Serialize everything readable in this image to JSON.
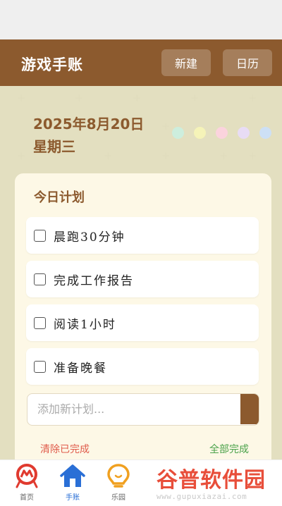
{
  "app": {
    "title": "游戏手账",
    "buttons": {
      "new": "新建",
      "calendar": "日历"
    }
  },
  "header": {
    "date": "2025年8月20日",
    "weekday": "星期三",
    "theme_dots": [
      "#cdeedd",
      "#f5f3b8",
      "#fbd3dd",
      "#e8dcf5",
      "#cde0f5"
    ]
  },
  "plan": {
    "title": "今日计划",
    "tasks": [
      {
        "label": "晨跑30分钟",
        "done": false
      },
      {
        "label": "完成工作报告",
        "done": false
      },
      {
        "label": "阅读1小时",
        "done": false
      },
      {
        "label": "准备晚餐",
        "done": false
      }
    ],
    "input_placeholder": "添加新计划...",
    "clear_done": "清除已完成",
    "complete_all": "全部完成"
  },
  "tabbar": {
    "tabs": [
      {
        "label": "首页",
        "icon": "home-brand-icon"
      },
      {
        "label": "手账",
        "icon": "house-icon",
        "active": true
      },
      {
        "label": "乐园",
        "icon": "lightbulb-icon"
      }
    ]
  },
  "watermark": {
    "title": "谷普软件园",
    "url": "www.gupuxiazai.com"
  },
  "colors": {
    "brand": "#8c5a2e",
    "background": "#f3f1d8",
    "danger": "#e05b4b",
    "success": "#4aa24a",
    "active_tab": "#2a6fd6"
  }
}
